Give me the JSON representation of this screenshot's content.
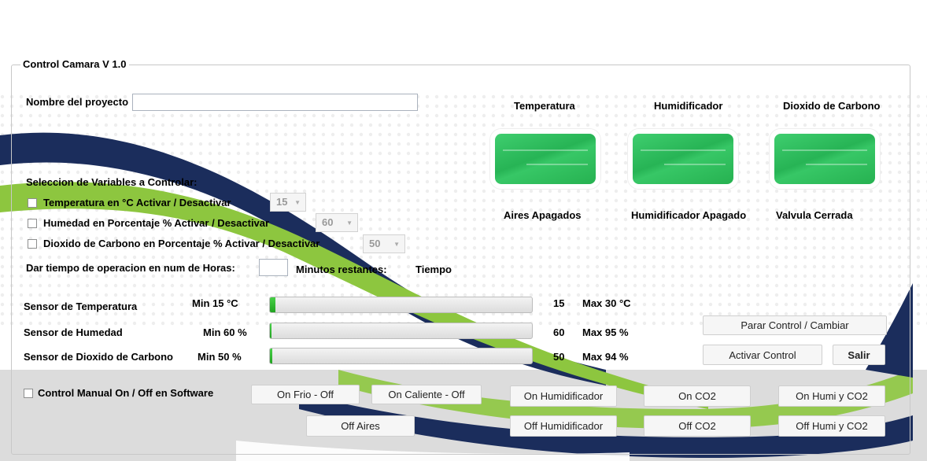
{
  "window": {
    "title": "Control Camara V 1.0"
  },
  "project": {
    "label": "Nombre del proyecto",
    "value": ""
  },
  "selection": {
    "heading": "Seleccion de Variables a Controlar:",
    "temperature": {
      "label": "Temperatura en °C  Activar / Desactivar",
      "checked": false,
      "value": "15"
    },
    "humidity": {
      "label": "Humedad  en Porcentaje %  Activar / Desactivar",
      "checked": false,
      "value": "60"
    },
    "co2": {
      "label": "Dioxido de Carbono en Porcentaje %  Activar / Desactivar",
      "checked": false,
      "value": "50"
    }
  },
  "time": {
    "label": "Dar tiempo de operacion en num de Horas:",
    "value": "",
    "remaining_label": "Minutos restantes:",
    "remaining_value": "Tiempo"
  },
  "status": {
    "temperature": {
      "title": "Temperatura",
      "state": "Aires Apagados"
    },
    "humidifier": {
      "title": "Humidificador",
      "state": "Humidificador Apagado"
    },
    "co2": {
      "title": "Dioxido de Carbono",
      "state": "Valvula Cerrada"
    }
  },
  "sensors": {
    "temperature": {
      "label": "Sensor de Temperatura",
      "min": "Min 15 °C",
      "value": "15",
      "max": "Max 30 °C",
      "progress": 0.02
    },
    "humidity": {
      "label": "Sensor de Humedad",
      "min": "Min 60 %",
      "value": "60",
      "max": "Max 95 %",
      "progress": 0.0
    },
    "co2": {
      "label": "Sensor de Dioxido de Carbono",
      "min": "Min 50 %",
      "value": "50",
      "max": "Max 94 %",
      "progress": 0.01
    }
  },
  "controls": {
    "stop": "Parar Control / Cambiar",
    "activate": "Activar Control",
    "exit": "Salir"
  },
  "manual": {
    "label": "Control Manual On / Off en Software",
    "checked": false,
    "on_cold": "On Frio - Off",
    "on_hot": "On Caliente - Off",
    "on_humidifier": "On Humidificador",
    "on_co2": "On CO2",
    "on_humi_co2": "On Humi y CO2",
    "off_aires": "Off Aires",
    "off_humidifier": "Off Humidificador",
    "off_co2": "Off CO2",
    "off_humi_co2": "Off Humi y CO2"
  },
  "colors": {
    "accent_green": "#8dc63f",
    "navy": "#1b2d5c",
    "status_green": "#2bbd5a",
    "progress_green": "#2fb52f"
  }
}
